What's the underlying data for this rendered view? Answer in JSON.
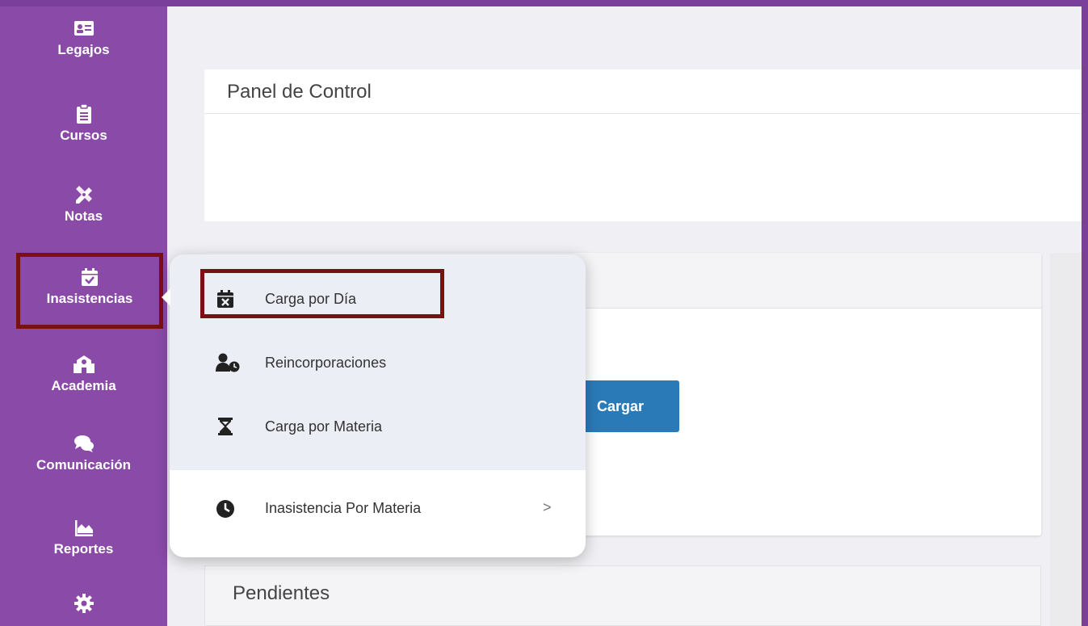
{
  "sidebar": {
    "items": [
      {
        "label": "Legajos",
        "icon": "id-card-icon"
      },
      {
        "label": "Cursos",
        "icon": "clipboard-icon"
      },
      {
        "label": "Notas",
        "icon": "ruler-pencil-icon"
      },
      {
        "label": "Inasistencias",
        "icon": "calendar-check-icon"
      },
      {
        "label": "Academia",
        "icon": "school-icon"
      },
      {
        "label": "Comunicación",
        "icon": "chat-bubbles-icon"
      },
      {
        "label": "Reportes",
        "icon": "area-chart-icon"
      },
      {
        "label": "",
        "icon": "gear-icon"
      }
    ]
  },
  "main": {
    "panel_title": "Panel de Control",
    "cargar_label": "Cargar",
    "pendientes_title": "Pendientes"
  },
  "dropdown": {
    "items": [
      {
        "label": "Carga por Día",
        "icon": "calendar-x-icon"
      },
      {
        "label": "Reincorporaciones",
        "icon": "user-clock-icon"
      },
      {
        "label": "Carga por Materia",
        "icon": "hourglass-icon"
      }
    ],
    "submenu": {
      "label": "Inasistencia Por Materia",
      "icon": "clock-icon",
      "arrow": ">"
    }
  },
  "colors": {
    "sidebar": "#8a4aa8",
    "accent_button": "#2a7ab8",
    "highlight": "#7a0f14"
  }
}
